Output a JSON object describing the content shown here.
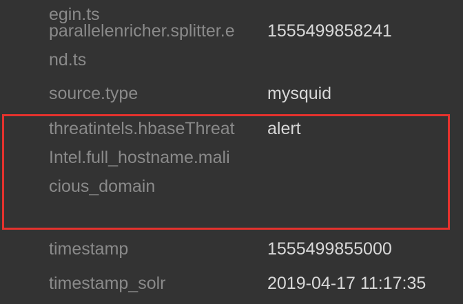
{
  "fields": {
    "rows": [
      {
        "key": "parallelenricher.splitter.begin.ts",
        "value": ""
      },
      {
        "key": "parallelenricher.splitter.end.ts",
        "value": "1555499858241"
      },
      {
        "key": "source.type",
        "value": "mysquid"
      },
      {
        "key": "threatintels.hbaseThreatIntel.full_hostname.malicious_domain",
        "value": "alert"
      },
      {
        "key": "timestamp",
        "value": "1555499855000"
      },
      {
        "key": "timestamp_solr",
        "value": "2019-04-17 11:17:35"
      }
    ]
  },
  "highlight": {
    "color": "#e5322d",
    "target_row": 3
  }
}
